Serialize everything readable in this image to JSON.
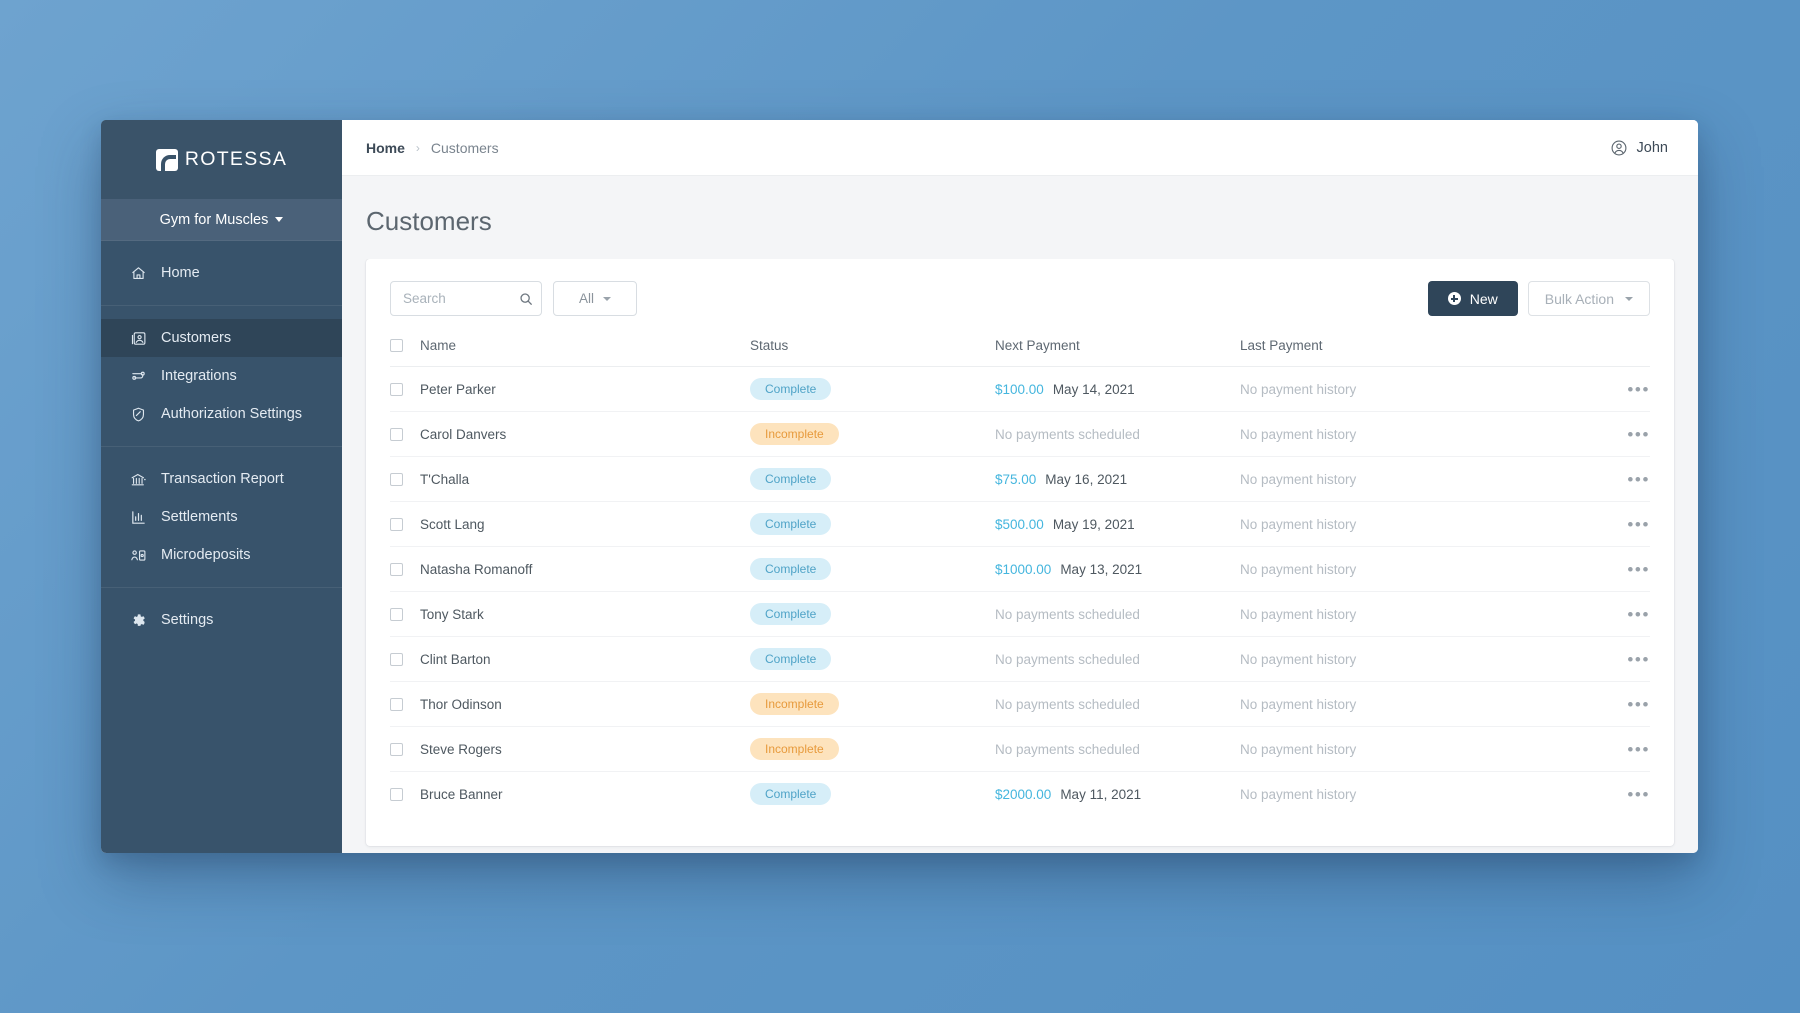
{
  "sidebar": {
    "logo_text": "ROTESSA",
    "org_switcher": "Gym for Muscles",
    "groups": [
      {
        "items": [
          {
            "label": "Home",
            "icon": "home-icon",
            "active": false
          }
        ]
      },
      {
        "items": [
          {
            "label": "Customers",
            "icon": "customers-icon",
            "active": true
          },
          {
            "label": "Integrations",
            "icon": "integrations-icon",
            "active": false
          },
          {
            "label": "Authorization Settings",
            "icon": "shield-icon",
            "active": false
          }
        ]
      },
      {
        "items": [
          {
            "label": "Transaction Report",
            "icon": "bank-icon",
            "active": false
          },
          {
            "label": "Settlements",
            "icon": "bar-chart-icon",
            "active": false
          },
          {
            "label": "Microdeposits",
            "icon": "microdeposits-icon",
            "active": false
          }
        ]
      },
      {
        "items": [
          {
            "label": "Settings",
            "icon": "gear-icon",
            "active": false
          }
        ]
      }
    ]
  },
  "topbar": {
    "breadcrumb_home": "Home",
    "breadcrumb_separator": "›",
    "breadcrumb_current": "Customers",
    "user_name": "John"
  },
  "page": {
    "title": "Customers"
  },
  "toolbar": {
    "search_placeholder": "Search",
    "search_value": "",
    "filter_label": "All",
    "new_label": "New",
    "bulk_action_label": "Bulk Action"
  },
  "table": {
    "columns": [
      "Name",
      "Status",
      "Next Payment",
      "Last Payment"
    ],
    "rows": [
      {
        "name": "Peter Parker",
        "status": "Complete",
        "amount": "$100.00",
        "date": "May 14, 2021",
        "next_empty": "",
        "last": "No payment history"
      },
      {
        "name": "Carol Danvers",
        "status": "Incomplete",
        "amount": "",
        "date": "",
        "next_empty": "No payments scheduled",
        "last": "No payment history"
      },
      {
        "name": "T'Challa",
        "status": "Complete",
        "amount": "$75.00",
        "date": "May 16, 2021",
        "next_empty": "",
        "last": "No payment history"
      },
      {
        "name": "Scott Lang",
        "status": "Complete",
        "amount": "$500.00",
        "date": "May 19, 2021",
        "next_empty": "",
        "last": "No payment history"
      },
      {
        "name": "Natasha Romanoff",
        "status": "Complete",
        "amount": "$1000.00",
        "date": "May 13, 2021",
        "next_empty": "",
        "last": "No payment history"
      },
      {
        "name": "Tony Stark",
        "status": "Complete",
        "amount": "",
        "date": "",
        "next_empty": "No payments scheduled",
        "last": "No payment history"
      },
      {
        "name": "Clint Barton",
        "status": "Complete",
        "amount": "",
        "date": "",
        "next_empty": "No payments scheduled",
        "last": "No payment history"
      },
      {
        "name": "Thor Odinson",
        "status": "Incomplete",
        "amount": "",
        "date": "",
        "next_empty": "No payments scheduled",
        "last": "No payment history"
      },
      {
        "name": "Steve Rogers",
        "status": "Incomplete",
        "amount": "",
        "date": "",
        "next_empty": "No payments scheduled",
        "last": "No payment history"
      },
      {
        "name": "Bruce Banner",
        "status": "Complete",
        "amount": "$2000.00",
        "date": "May 11, 2021",
        "next_empty": "",
        "last": "No payment history"
      }
    ],
    "row_menu_glyph": "•••"
  },
  "colors": {
    "sidebar_bg": "#38536b",
    "sidebar_active": "#2f4558",
    "org_switcher_bg": "#4a6179",
    "primary_button": "#2f4559",
    "amount_link": "#45b6de",
    "badge_complete_bg": "#d6eef8",
    "badge_complete_text": "#4fa3c7",
    "badge_incomplete_bg": "#fde3bd",
    "badge_incomplete_text": "#e79a3c",
    "page_bg": "#f4f5f7",
    "desktop_bg": "#5d96c6"
  }
}
